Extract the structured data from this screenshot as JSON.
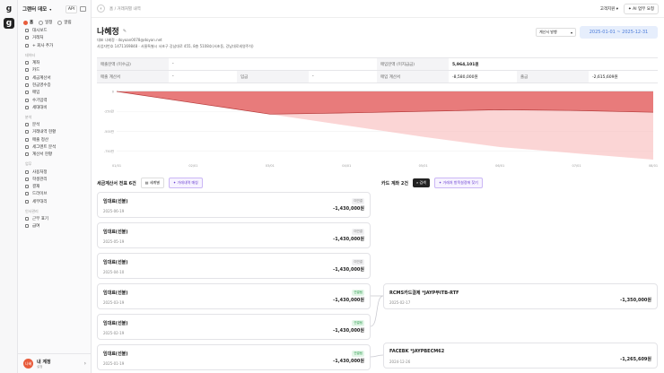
{
  "rail": {
    "logo1": "g",
    "logo2": "g"
  },
  "sidebar": {
    "company": "그랜터 데모",
    "api": "API",
    "tabs": [
      {
        "label": "홈"
      },
      {
        "label": "일정"
      },
      {
        "label": "알림"
      }
    ],
    "top_items": [
      {
        "label": "대시보드"
      },
      {
        "label": "거래처"
      },
      {
        "label": "+ 회사 추가"
      }
    ],
    "section1": "데이터",
    "section1_items": [
      {
        "label": "계좌"
      },
      {
        "label": "카드"
      },
      {
        "label": "세금계산서"
      },
      {
        "label": "현금영수증"
      },
      {
        "label": "매입"
      },
      {
        "label": "수기입력"
      },
      {
        "label": "세대대비"
      }
    ],
    "section2": "분석",
    "section2_items": [
      {
        "label": "분석"
      },
      {
        "label": "거래내역 현황"
      },
      {
        "label": "매출 정산"
      },
      {
        "label": "세그멘트 분석"
      },
      {
        "label": "계산서 현황"
      }
    ],
    "section3": "업무",
    "section3_items": [
      {
        "label": "사용처정"
      },
      {
        "label": "학생관리"
      },
      {
        "label": "결재"
      },
      {
        "label": "드라이브"
      },
      {
        "label": "세무대리"
      }
    ],
    "section4": "인사관리",
    "section4_items": [
      {
        "label": "근무 표기"
      },
      {
        "label": "급여"
      }
    ],
    "user": {
      "avatar": "나혜",
      "name": "내 계정",
      "sub": "설정"
    }
  },
  "header": {
    "breadcrumb": "홈 / 거래처별 내역",
    "support": "고객지원",
    "ai_button": "AI 업무 요청"
  },
  "title": {
    "name": "나혜정",
    "edit_icon": "✎",
    "line1": "대표 나혜정 · doyoan0078@doyan.net",
    "line2": "사업자번호 1471169848 · 서울특별시 서초구 강남대로 455, 8층 5108호(서초동, 강남대로세영주차)"
  },
  "filters": {
    "dropdown": "계산서 발행",
    "date_range": "2025-01-01 ~ 2025-12-31"
  },
  "summary": {
    "row1": [
      {
        "label": "매출잔액 (미수금)",
        "value": "-"
      },
      {
        "label": "매입잔액 (미지급금)",
        "value": "5,964,101원"
      }
    ],
    "row2": [
      {
        "label": "매출 계산서",
        "value": "-"
      },
      {
        "label": "입금",
        "value": "-"
      },
      {
        "label": "매입 계산서",
        "value": "-8,580,000원"
      },
      {
        "label": "출금",
        "value": "-2,615,609원"
      }
    ]
  },
  "chart_data": {
    "type": "area",
    "x": [
      "01/01",
      "02/01",
      "03/01",
      "04/01",
      "05/01",
      "06/01",
      "07/01",
      "08/01"
    ],
    "y_ticks": [
      "0",
      "-250만",
      "-500만",
      "-750만"
    ],
    "ylim": [
      -8580000,
      0
    ],
    "series": [
      {
        "values": [
          0,
          -1430000,
          -2860000,
          -2700000,
          -2500000,
          -2300000,
          -2400000,
          -2615609
        ],
        "color": "#e25c5c"
      },
      {
        "values": [
          0,
          -1430000,
          -2860000,
          -4290000,
          -5720000,
          -7000000,
          -7800000,
          -8580000
        ],
        "color": "#f7b3b3"
      }
    ]
  },
  "tax_section": {
    "title": "세금계산서 전표 6건",
    "btn1": "세계별",
    "btn2": "거래내역 매칭"
  },
  "card_section": {
    "title": "카드 계좌 2건",
    "btn1": "검색",
    "btn2": "거래처 항목설정에 찾기"
  },
  "tax_items": [
    {
      "name": "임대료(선불)",
      "date": "2025-06-19",
      "badge": "미연결",
      "amount": "-1,430,000원",
      "linked": false
    },
    {
      "name": "임대료(선불)",
      "date": "2025-05-19",
      "badge": "미연결",
      "amount": "-1,430,000원",
      "linked": false
    },
    {
      "name": "임대료(선불)",
      "date": "2025-04-10",
      "badge": "미연결",
      "amount": "-1,430,000원",
      "linked": false
    },
    {
      "name": "임대료(선불)",
      "date": "2025-03-19",
      "badge": "연결됨",
      "amount": "-1,430,000원",
      "linked": true
    },
    {
      "name": "임대료(선불)",
      "date": "2025-02-19",
      "badge": "연결됨",
      "amount": "-1,430,000원",
      "linked": true
    },
    {
      "name": "임대료(선불)",
      "date": "2025-01-19",
      "badge": "연결됨",
      "amount": "-1,430,000원",
      "linked": true
    }
  ],
  "card_items": [
    {
      "name": "RCMS카드결제 *JAYP부ITB-RTF",
      "date": "2025-02-17",
      "amount": "-1,350,000원"
    },
    {
      "name": "FACEBK *JAYPBECM62",
      "date": "2024-12-26",
      "amount": "-1,265,609원"
    }
  ]
}
